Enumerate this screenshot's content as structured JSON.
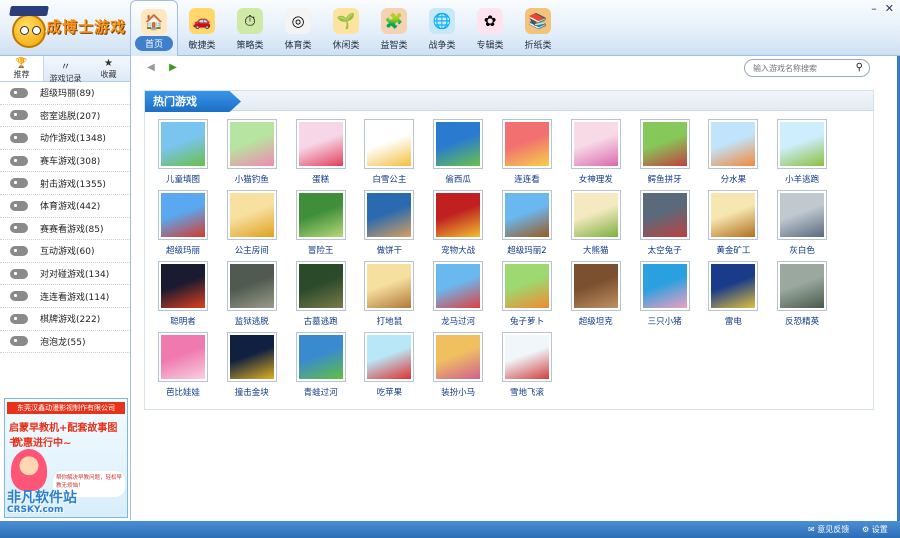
{
  "app": {
    "logo_text": "成博士游戏",
    "window_controls": [
      "–",
      "✕"
    ]
  },
  "nav": [
    {
      "label": "首页",
      "icon": "home-icon",
      "glyph": "🏠",
      "bg": "#ffe8c0",
      "active": true
    },
    {
      "label": "敏捷类",
      "icon": "car-icon",
      "glyph": "🚗",
      "bg": "#ffd76a"
    },
    {
      "label": "策略类",
      "icon": "clock-icon",
      "glyph": "⏱",
      "bg": "#cfe9a7"
    },
    {
      "label": "体育类",
      "icon": "dartboard-icon",
      "glyph": "◎",
      "bg": "#f4f4f4"
    },
    {
      "label": "休闲类",
      "icon": "plant-icon",
      "glyph": "🌱",
      "bg": "#fde3a0"
    },
    {
      "label": "益智类",
      "icon": "puzzle-icon",
      "glyph": "🧩",
      "bg": "#f6d2b5"
    },
    {
      "label": "战争类",
      "icon": "globe-icon",
      "glyph": "🌐",
      "bg": "#c8e8f7"
    },
    {
      "label": "专辑类",
      "icon": "pinwheel-icon",
      "glyph": "✿",
      "bg": "#ffe4f0"
    },
    {
      "label": "折纸类",
      "icon": "book-icon",
      "glyph": "📚",
      "bg": "#f4c37a"
    }
  ],
  "sidebar": {
    "tabs": [
      {
        "label": "推荐",
        "icon": "trophy-icon",
        "glyph": "🏆",
        "active": true
      },
      {
        "label": "游戏记录",
        "icon": "record-icon",
        "glyph": "〃"
      },
      {
        "label": "收藏",
        "icon": "star-icon",
        "glyph": "★"
      }
    ],
    "categories": [
      "超级玛丽(89)",
      "密室逃脱(207)",
      "动作游戏(1348)",
      "赛车游戏(308)",
      "射击游戏(1355)",
      "体育游戏(442)",
      "赛赛看游戏(85)",
      "互动游戏(60)",
      "对对碰游戏(134)",
      "连连看游戏(114)",
      "棋牌游戏(222)",
      "泡泡龙(55)"
    ],
    "ad": {
      "company": "东莞汉鑫动漫影视制作有限公司",
      "line1": "启蒙早教机+配套故事图书",
      "line2": "优惠进行中~",
      "bubble": "帮你解决早教问题，轻松早教无烦恼！"
    },
    "watermark": {
      "main": "非凡软件站",
      "sub": "CRSKY.com"
    }
  },
  "toolbar": {
    "search_placeholder": "输入游戏名称搜索"
  },
  "panel": {
    "title": "热门游戏"
  },
  "games": [
    {
      "name": "儿童填图",
      "c1": "#7ac4f0",
      "c2": "#6cc04a"
    },
    {
      "name": "小猫钓鱼",
      "c1": "#b7e4a0",
      "c2": "#f08ab0"
    },
    {
      "name": "蛋糕",
      "c1": "#f7d6e8",
      "c2": "#e0405a"
    },
    {
      "name": "白雪公主",
      "c1": "#ffffff",
      "c2": "#f2c040"
    },
    {
      "name": "偷西瓜",
      "c1": "#2a7bd0",
      "c2": "#69c34a"
    },
    {
      "name": "连连看",
      "c1": "#f27070",
      "c2": "#f7d04a"
    },
    {
      "name": "女神理发",
      "c1": "#f8d9e6",
      "c2": "#d86ab0"
    },
    {
      "name": "鳄鱼拼牙",
      "c1": "#86c95a",
      "c2": "#c04040"
    },
    {
      "name": "分水果",
      "c1": "#c0e4fb",
      "c2": "#f08a3a"
    },
    {
      "name": "小羊逃跑",
      "c1": "#cfeefd",
      "c2": "#8bbf3f"
    },
    {
      "name": "超级玛丽",
      "c1": "#5aa8f0",
      "c2": "#d83a2a"
    },
    {
      "name": "公主房间",
      "c1": "#f7e0a0",
      "c2": "#e0a020"
    },
    {
      "name": "冒险王",
      "c1": "#3f8f3a",
      "c2": "#b8d878"
    },
    {
      "name": "做饼干",
      "c1": "#2a6ab0",
      "c2": "#d8a060"
    },
    {
      "name": "宠物大战",
      "c1": "#c02020",
      "c2": "#f0c030"
    },
    {
      "name": "超级玛丽2",
      "c1": "#6ab8f0",
      "c2": "#9a5a20"
    },
    {
      "name": "大熊猫",
      "c1": "#f4e9c0",
      "c2": "#7ab040"
    },
    {
      "name": "太空兔子",
      "c1": "#5a6a7a",
      "c2": "#c04040"
    },
    {
      "name": "黄金矿工",
      "c1": "#f6e6b0",
      "c2": "#b07020"
    },
    {
      "name": "灰白色",
      "c1": "#c0c8d0",
      "c2": "#5a6a80"
    },
    {
      "name": "聪明者",
      "c1": "#1a1a30",
      "c2": "#e04020"
    },
    {
      "name": "监狱逃脱",
      "c1": "#505a50",
      "c2": "#9a9a8a"
    },
    {
      "name": "古墓逃跑",
      "c1": "#2a4a2a",
      "c2": "#7a7a4a"
    },
    {
      "name": "打地鼠",
      "c1": "#f6e0a0",
      "c2": "#b0783a"
    },
    {
      "name": "龙马过河",
      "c1": "#6ab8f0",
      "c2": "#e04040"
    },
    {
      "name": "兔子萝卜",
      "c1": "#9ed870",
      "c2": "#f08a30"
    },
    {
      "name": "超级坦克",
      "c1": "#7a5030",
      "c2": "#c09060"
    },
    {
      "name": "三只小猪",
      "c1": "#2aa0e0",
      "c2": "#f0a0c0"
    },
    {
      "name": "雷电",
      "c1": "#1a3a8a",
      "c2": "#e0c040"
    },
    {
      "name": "反恐精英",
      "c1": "#9aa8a0",
      "c2": "#4a5a4a"
    },
    {
      "name": "芭比娃娃",
      "c1": "#f07ab0",
      "c2": "#f8d0e0"
    },
    {
      "name": "撞击金块",
      "c1": "#102040",
      "c2": "#e0b020"
    },
    {
      "name": "青蛙过河",
      "c1": "#3a8ad0",
      "c2": "#60c040"
    },
    {
      "name": "吃苹果",
      "c1": "#b8e8f8",
      "c2": "#e03030"
    },
    {
      "name": "装扮小马",
      "c1": "#f0c060",
      "c2": "#d06090"
    },
    {
      "name": "雪地飞滚",
      "c1": "#f0f6fa",
      "c2": "#d04040"
    }
  ],
  "status": {
    "feedback": "意见反馈",
    "settings": "设置"
  }
}
